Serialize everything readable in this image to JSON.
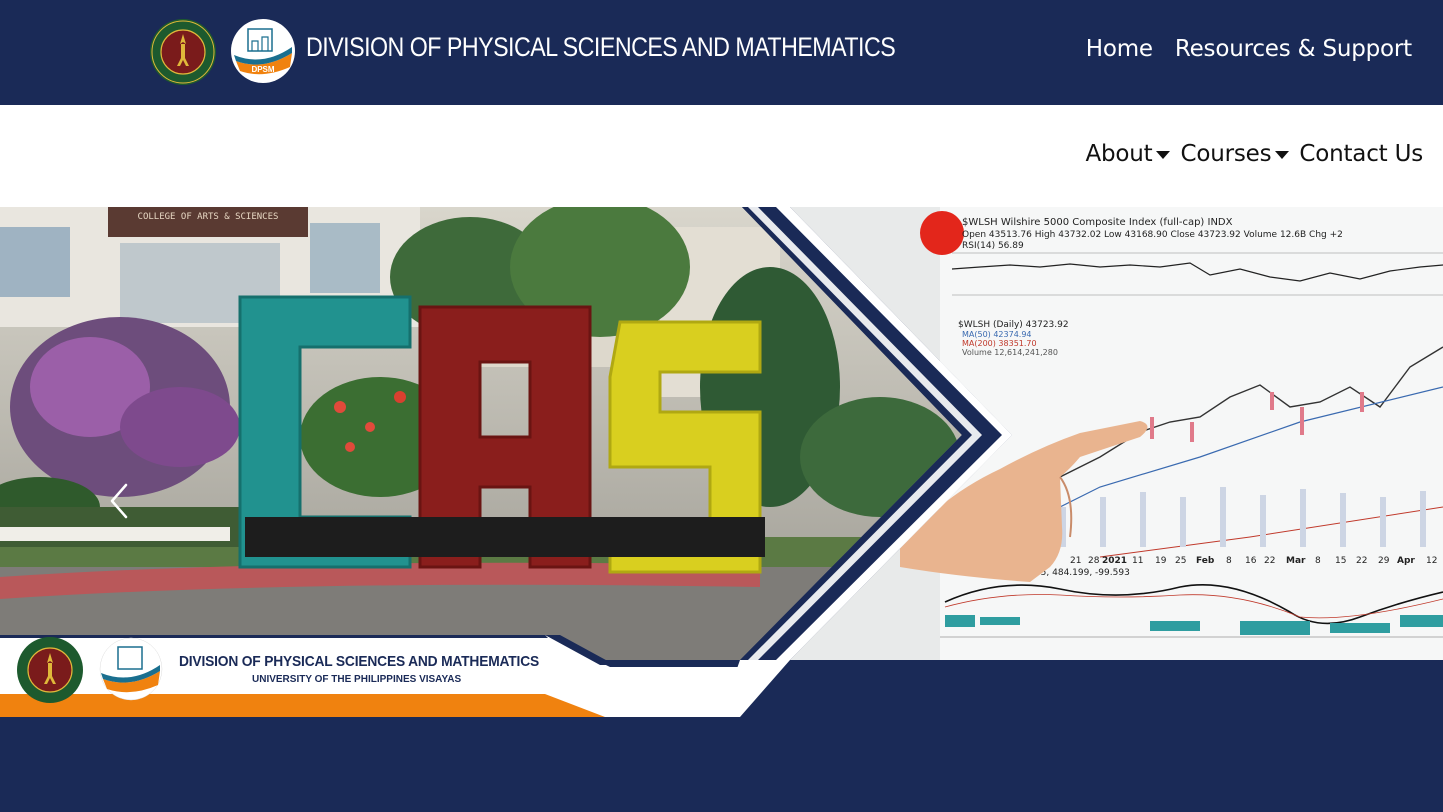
{
  "header": {
    "title": "DIVISION OF PHYSICAL SCIENCES AND MATHEMATICS",
    "nav": [
      "Home",
      "Resources & Support"
    ]
  },
  "main_nav": {
    "items": [
      {
        "label": "About",
        "dropdown": true
      },
      {
        "label": "Courses",
        "dropdown": true
      },
      {
        "label": "Contact Us",
        "dropdown": false
      }
    ]
  },
  "hero": {
    "sign_text": "CAS",
    "building_sign": "COLLEGE OF ARTS & SCIENCES",
    "banner_title": "DIVISION OF PHYSICAL SCIENCES AND MATHEMATICS",
    "banner_subtitle": "UNIVERSITY OF THE PHILIPPINES VISAYAS",
    "logo_up_text": "UNIVERSITY OF THE PHILIPPINES",
    "logo_dpsm_text": "DPSM",
    "chart_title": "$WLSH Wilshire 5000 Composite Index (full-cap) INDX",
    "chart_ohlc": "Open 43513.76  High 43732.02  Low 43168.90  Close 43723.92  Volume 12.6B  Chg +2",
    "chart_rsi": "RSI(14) 56.89",
    "chart_daily": "$WLSH (Daily) 43723.92",
    "chart_ma50": "MA(50) 42374.94",
    "chart_ma200": "MA(200) 38351.70",
    "chart_volume": "Volume 12,614,241,280",
    "chart_macd": "MACD(12,26,9) 605, 484.199, -99.593",
    "chart_dates": [
      "21",
      "28",
      "2021",
      "11",
      "19",
      "25",
      "Feb",
      "8",
      "16",
      "22",
      "Mar",
      "8",
      "15",
      "22",
      "29",
      "Apr",
      "12"
    ]
  },
  "colors": {
    "navy": "#1a2a57",
    "orange": "#f0820f",
    "white": "#ffffff"
  },
  "icons": {
    "prev": "chevron-left-icon",
    "caret": "caret-down-icon"
  }
}
